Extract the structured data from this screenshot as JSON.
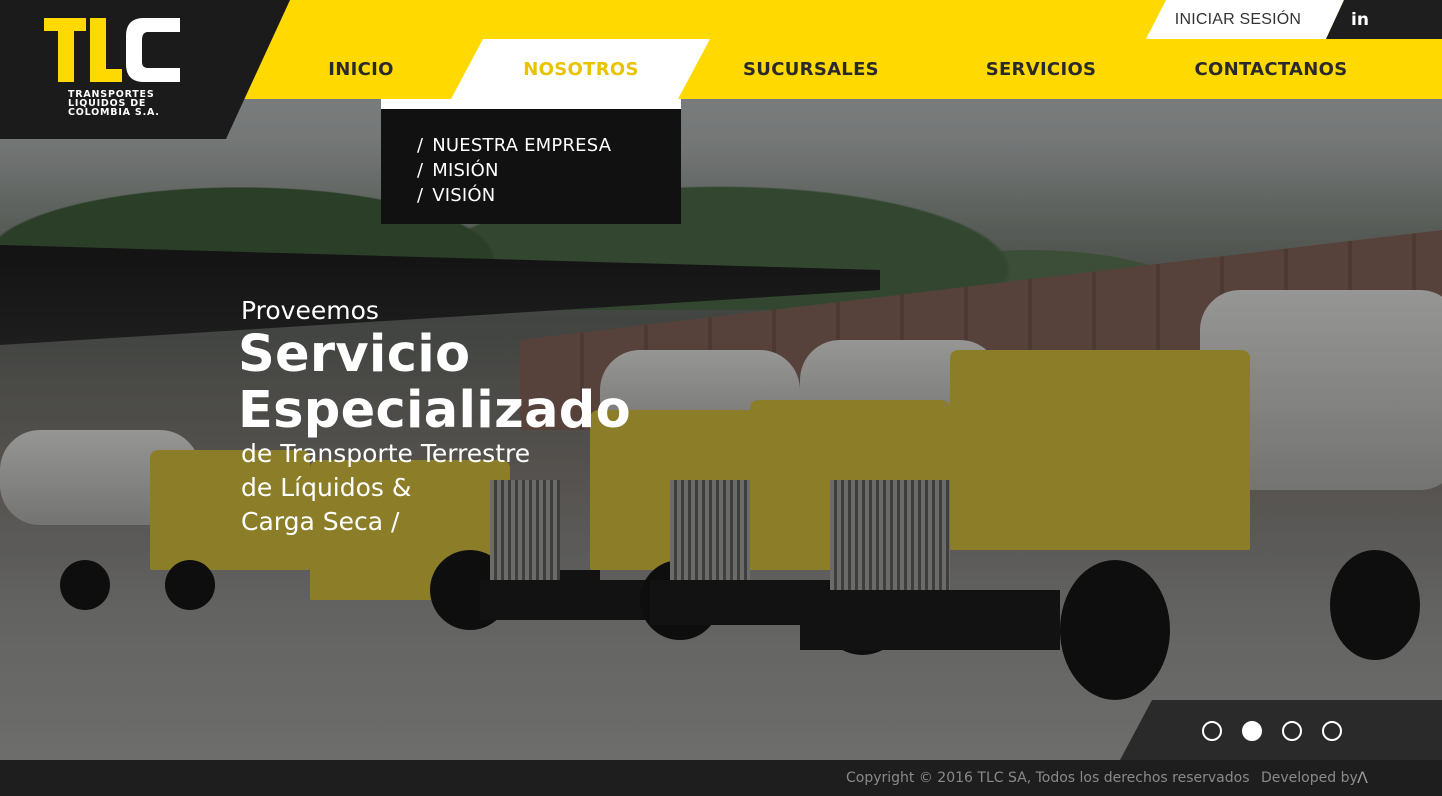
{
  "brand": {
    "mark": "TLC",
    "name_lines": [
      "TRANSPORTES",
      "LIQUIDOS DE",
      "COLOMBIA S.A."
    ],
    "accent_color": "#ffd900",
    "dark_color": "#1b1b1b"
  },
  "topbar": {
    "login_label": "INICIAR SESIÓN",
    "social_label": "in",
    "social_icon": "linkedin-icon"
  },
  "nav": {
    "items": [
      {
        "label": "INICIO",
        "active": false
      },
      {
        "label": "NOSOTROS",
        "active": true
      },
      {
        "label": "SUCURSALES",
        "active": false
      },
      {
        "label": "SERVICIOS",
        "active": false
      },
      {
        "label": "CONTACTANOS",
        "active": false
      }
    ],
    "dropdown": {
      "separator": "/",
      "items": [
        "NUESTRA EMPRESA",
        "MISIÓN",
        "VISIÓN"
      ]
    }
  },
  "hero": {
    "pre": "Proveemos",
    "title_lines": [
      "Servicio",
      "Especializado"
    ],
    "sub_lines": [
      "de Transporte Terrestre",
      "de Líquidos &",
      "Carga Seca /"
    ]
  },
  "slider": {
    "total": 4,
    "active_index": 1
  },
  "footer": {
    "copyright": "Copyright © 2016 TLC SA, Todos los derechos reservados",
    "developed_by": "Developed by",
    "developer_icon": "Λ"
  }
}
